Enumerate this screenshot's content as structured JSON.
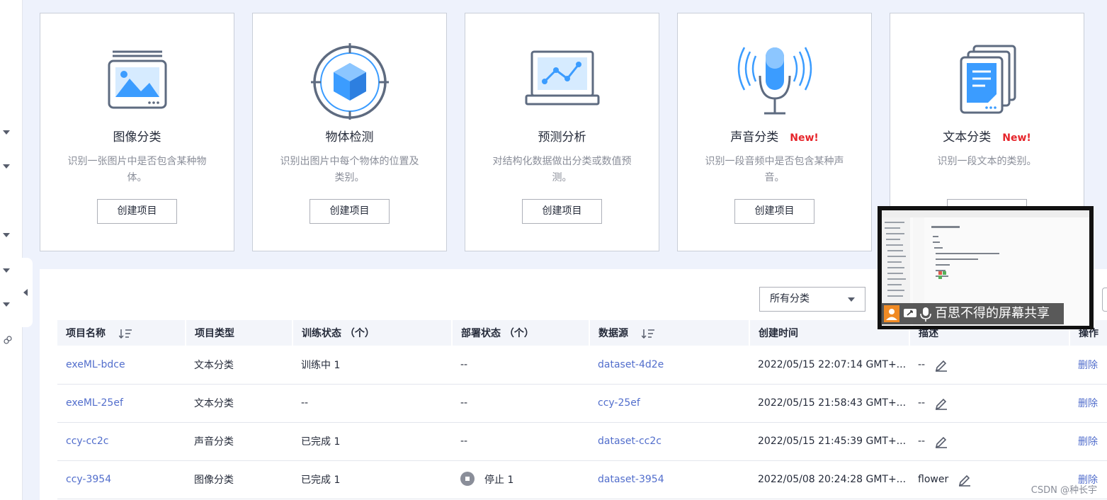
{
  "cards": [
    {
      "title": "图像分类",
      "desc": "识别一张图片中是否包含某种物体。",
      "button": "创建项目",
      "icon": "image-classification-icon"
    },
    {
      "title": "物体检测",
      "desc": "识别出图片中每个物体的位置及类别。",
      "button": "创建项目",
      "icon": "object-detection-icon"
    },
    {
      "title": "预测分析",
      "desc": "对结构化数据做出分类或数值预测。",
      "button": "创建项目",
      "icon": "predictive-analysis-icon"
    },
    {
      "title": "声音分类",
      "badge": "New!",
      "desc": "识别一段音频中是否包含某种声音。",
      "button": "创建项目",
      "icon": "sound-classification-icon"
    },
    {
      "title": "文本分类",
      "badge": "New!",
      "desc": "识别一段文本的类别。",
      "icon": "text-classification-icon"
    }
  ],
  "filter": {
    "selected": "所有分类"
  },
  "table": {
    "headers": {
      "name": "项目名称",
      "type": "项目类型",
      "train": "训练状态 （个）",
      "deploy": "部署状态 （个）",
      "source": "数据源",
      "created": "创建时间",
      "desc": "描述",
      "op": "操作"
    },
    "rows": [
      {
        "name": "exeML-bdce",
        "type": "文本分类",
        "train": "训练中 1",
        "deploy": "--",
        "source": "dataset-4d2e",
        "created": "2022/05/15 22:07:14 GMT+...",
        "desc": "--",
        "op": "删除"
      },
      {
        "name": "exeML-25ef",
        "type": "文本分类",
        "train": "--",
        "deploy": "--",
        "source": "ccy-25ef",
        "created": "2022/05/15 21:58:43 GMT+...",
        "desc": "--",
        "op": "删除"
      },
      {
        "name": "ccy-cc2c",
        "type": "声音分类",
        "train": "已完成 1",
        "deploy": "--",
        "source": "dataset-cc2c",
        "created": "2022/05/15 21:45:39 GMT+...",
        "desc": "--",
        "op": "删除"
      },
      {
        "name": "ccy-3954",
        "type": "图像分类",
        "train": "已完成 1",
        "deploy": "停止 1",
        "source": "dataset-3954",
        "created": "2022/05/08 20:24:28 GMT+...",
        "desc": "flower",
        "op": "删除"
      }
    ]
  },
  "share": {
    "label": "百思不得的屏幕共享"
  },
  "watermark": "CSDN @种长宇",
  "colors": {
    "link": "#526ecc",
    "new_badge": "#e6252b",
    "accent_blue": "#3b9cff",
    "icon_outline": "#5e6b80"
  }
}
